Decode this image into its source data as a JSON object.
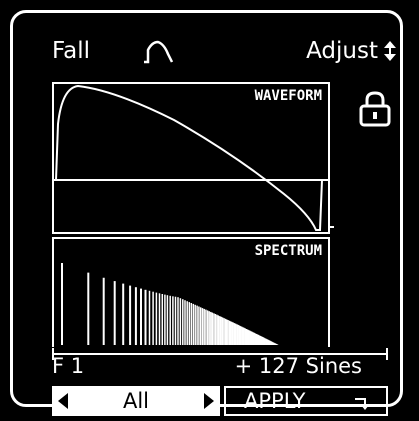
{
  "header": {
    "left_label": "Fall",
    "right_label": "Adjust",
    "fall_icon": "fall-curve-icon",
    "adjust_icon": "up-down-arrows-icon"
  },
  "waveform": {
    "label": "WAVEFORM"
  },
  "spectrum": {
    "label": "SPECTRUM"
  },
  "lock_icon": "padlock-icon",
  "info": {
    "left": "F 1",
    "right": "+ 127 Sines"
  },
  "buttons": {
    "all_label": "All",
    "apply_label": "APPLY",
    "apply_icon": "return-arrow-icon"
  },
  "colors": {
    "background": "#000000",
    "foreground": "#ffffff"
  }
}
